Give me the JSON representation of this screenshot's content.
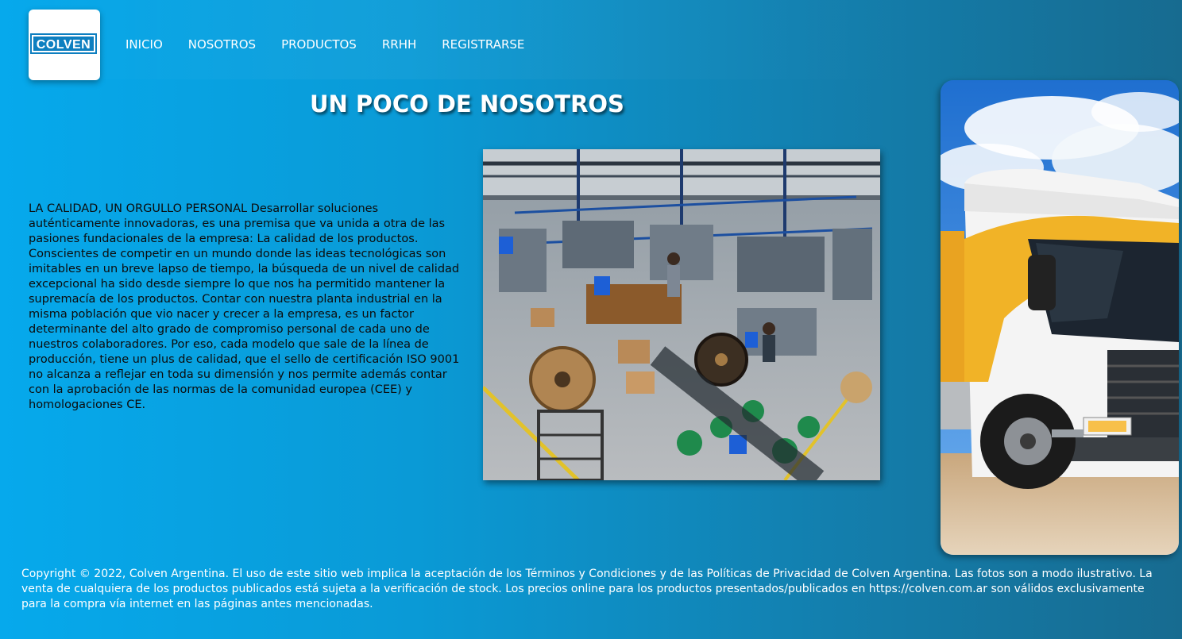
{
  "header": {
    "logo_text": "COLVEN",
    "nav": [
      {
        "label": "INICIO"
      },
      {
        "label": "NOSOTROS"
      },
      {
        "label": "PRODUCTOS"
      },
      {
        "label": "RRHH"
      },
      {
        "label": "REGISTRARSE"
      }
    ]
  },
  "main": {
    "title": "UN POCO DE NOSOTROS",
    "paragraph": "LA CALIDAD, UN ORGULLO PERSONAL Desarrollar soluciones auténticamente innovadoras, es una premisa que va unida a otra de las pasiones fundacionales de la empresa: La calidad de los productos. Conscientes de competir en un mundo donde las ideas tecnológicas son imitables en un breve lapso de tiempo, la búsqueda de un nivel de calidad excepcional ha sido desde siempre lo que nos ha permitido mantener la supremacía de los productos. Contar con nuestra planta industrial en la misma población que vio nacer y crecer a la empresa, es un factor determinante del alto grado de compromiso personal de cada uno de nuestros colaboradores. Por eso, cada modelo que sale de la línea de producción, tiene un plus de calidad, que el sello de certificación ISO 9001 no alcanza a reflejar en toda su dimensión y nos permite además contar con la aprobación de las normas de la comunidad europea (CEE) y homologaciones CE."
  },
  "footer": {
    "text": "Copyright © 2022, Colven Argentina. El uso de este sitio web implica la aceptación de los Términos y Condiciones y de las Políticas de Privacidad de Colven Argentina. Las fotos son a modo ilustrativo. La venta de cualquiera de los productos publicados está sujeta a la verificación de stock. Los precios online para los productos presentados/publicados en https://colven.com.ar son válidos exclusivamente para la compra vía internet en las páginas antes mencionadas."
  },
  "colors": {
    "background_start": "#06a9ec",
    "background_end": "#176b90",
    "logo_blue": "#0e7fc0",
    "text_white": "#ffffff"
  }
}
